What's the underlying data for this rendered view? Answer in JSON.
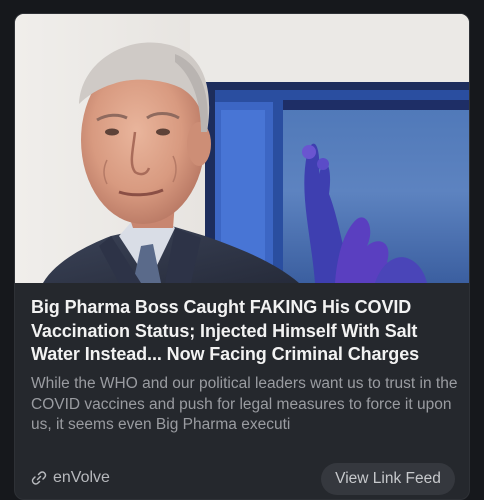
{
  "card": {
    "headline": "Big Pharma Boss Caught FAKING His COVID Vaccination Status; Injected Himself With Salt Water Instead... Now Facing Criminal Charges",
    "snippet": "While the WHO and our political leaders want us to trust in the COVID vaccines and push for legal measures to force it upon us, it seems even Big Pharma executi",
    "source": {
      "icon": "link-icon",
      "name": "enVolve"
    },
    "action_button": "View Link Feed",
    "image": {
      "depicts": "photo of older man in suit in front of aquarium"
    }
  },
  "colors": {
    "page_background": "#16181c",
    "card_background": "#25282d",
    "headline_text": "#f2f2f2",
    "snippet_text": "#9a9ca1",
    "button_background": "#35383e"
  }
}
